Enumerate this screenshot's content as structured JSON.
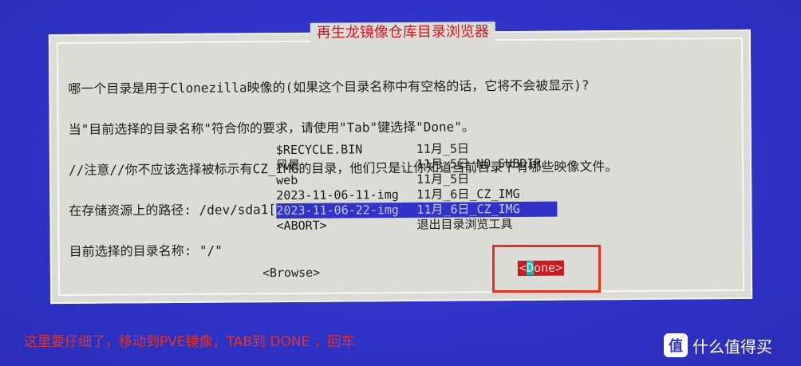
{
  "dialog": {
    "title": "再生龙镜像仓库目录浏览器",
    "description": [
      "哪一个目录是用于Clonezilla映像的(如果这个目录名称中有空格的话，它将不会被显示)?",
      "当\"目前选择的目录名称\"符合你的要求，请使用\"Tab\"键选择\"Done\"。",
      "//注意//你不应该选择被标示有CZ_IMG的目录，他们只是让你知道当前目录下有哪些映像文件。",
      "在存储资源上的路径: /dev/sda1[/]",
      "目前选择的目录名称: \"/\""
    ],
    "entries": [
      {
        "name": "$RECYCLE.BIN",
        "info": "11月_5日"
      },
      {
        "name": "风景",
        "info": "11月_5日_NO_SUBDIR"
      },
      {
        "name": "web",
        "info": "11月_5日"
      },
      {
        "name": "2023-11-06-11-img",
        "info": "11月_6日_CZ_IMG"
      },
      {
        "name": "2023-11-06-22-img",
        "info": "11月_6日_CZ_IMG"
      },
      {
        "name": "<ABORT>",
        "info": "退出目录浏览工具"
      }
    ],
    "browse_label": "<Browse>",
    "done_open": "<",
    "done_cursor": "D",
    "done_rest": "one>"
  },
  "caption": "这里要仔细了，移动到PVE镜像，TAB到 DONE ，回车",
  "watermark": {
    "icon": "值",
    "text": "什么值得买"
  },
  "colors": {
    "background": "#2f33c8",
    "dialog": "#dcdcd6",
    "title": "#d0161e",
    "selection": "#2f33c8",
    "done_button": "#d0161e",
    "annotation": "#e8321f"
  }
}
